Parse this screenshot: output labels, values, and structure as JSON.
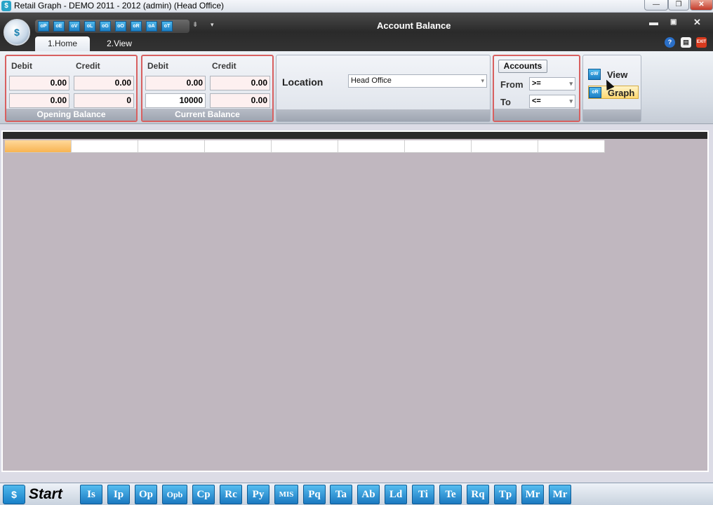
{
  "window": {
    "title": "Retail Graph - DEMO  2011 - 2012 (admin) (Head Office)",
    "min": "—",
    "max": "❐",
    "close": "✕"
  },
  "app": {
    "logo": "$",
    "title": "Account Balance",
    "quick_access": [
      "oP",
      "oE",
      "oV",
      "oL",
      "oG",
      "oO",
      "oR",
      "oA",
      "oT"
    ],
    "qat_more": "▾",
    "qat_customize": "⇟",
    "min": "▬",
    "max": "▣",
    "close": "✕",
    "help": "?",
    "doc": "▤",
    "exit": "EXIT"
  },
  "tabs": [
    {
      "label": "1.Home",
      "active": true
    },
    {
      "label": "2.View",
      "active": false
    }
  ],
  "opening_balance": {
    "group_label": "Opening Balance",
    "debit_label": "Debit",
    "credit_label": "Credit",
    "debit_1": "0.00",
    "credit_1": "0.00",
    "debit_2": "0.00",
    "credit_2": "0"
  },
  "current_balance": {
    "group_label": "Current Balance",
    "debit_label": "Debit",
    "credit_label": "Credit",
    "debit_1": "0.00",
    "credit_1": "0.00",
    "debit_2": "10000",
    "credit_2": "0.00"
  },
  "location": {
    "label": "Location",
    "value": "Head Office"
  },
  "accounts": {
    "button_label": "Accounts",
    "from_label": "From",
    "from_value": ">=",
    "to_label": "To",
    "to_value": "<="
  },
  "actions": {
    "view_icon": "oW",
    "view_label": "View",
    "graph_icon": "oR",
    "graph_label": "Graph"
  },
  "grid": {
    "columns": 9,
    "selected_column": 0
  },
  "taskbar": {
    "start_icon": "$",
    "start_label": "Start",
    "buttons": [
      "Is",
      "Ip",
      "Op",
      "Opb",
      "Cp",
      "Rc",
      "Py",
      "MIS",
      "Pq",
      "Ta",
      "Ab",
      "Ld",
      "Ti",
      "Te",
      "Rq",
      "Tp",
      "Mr",
      "Mr"
    ]
  },
  "colors": {
    "accent": "#1c7fc4",
    "group_border": "#d86060",
    "grid_bg": "#c0b7bf",
    "selection": "#f8b452"
  }
}
